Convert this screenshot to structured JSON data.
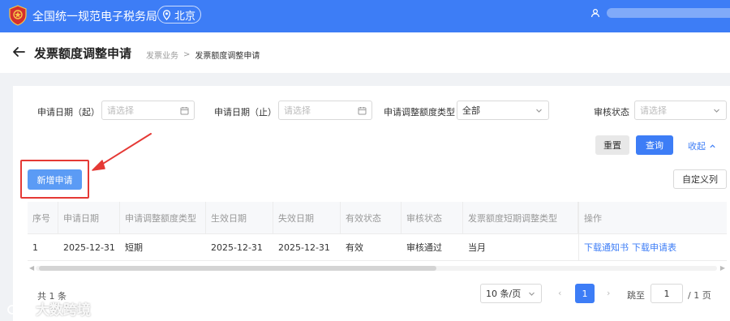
{
  "header": {
    "site_title": "全国统一规范电子税务局",
    "region": "北京",
    "brand_color": "#3d7df6"
  },
  "titlebar": {
    "page_title": "发票额度调整申请",
    "breadcrumb": [
      "发票业务",
      "发票额度调整申请"
    ],
    "breadcrumb_sep": ">"
  },
  "filters": {
    "start_date": {
      "label": "申请日期（起）",
      "placeholder": "请选择"
    },
    "end_date": {
      "label": "申请日期（止）",
      "placeholder": "请选择"
    },
    "quota_type": {
      "label": "申请调整额度类型",
      "value": "全部"
    },
    "review_status": {
      "label": "审核状态",
      "placeholder": "请选择"
    }
  },
  "actions": {
    "reset": "重置",
    "query": "查询",
    "collapse": "收起",
    "add": "新增申请",
    "custom_columns": "自定义列"
  },
  "table": {
    "columns": [
      "序号",
      "申请日期",
      "申请调整额度类型",
      "生效日期",
      "失效日期",
      "有效状态",
      "审核状态",
      "发票额度短期调整类型",
      "操作"
    ],
    "rows": [
      {
        "cells": [
          "1",
          "2025-12-31",
          "短期",
          "2025-12-31",
          "2025-12-31",
          "有效",
          "审核通过",
          "当月"
        ],
        "ops": [
          "下载通知书",
          "下载申请表"
        ]
      }
    ]
  },
  "pagination": {
    "total": "共 1 条",
    "page_size": "10 条/页",
    "current_page": "1",
    "jump_label": "跳至",
    "jump_value": "1",
    "total_pages": "/ 1 页"
  },
  "watermark": "大数跨境",
  "colors": {
    "accent": "#3d7df6",
    "annotation": "#e53935"
  }
}
